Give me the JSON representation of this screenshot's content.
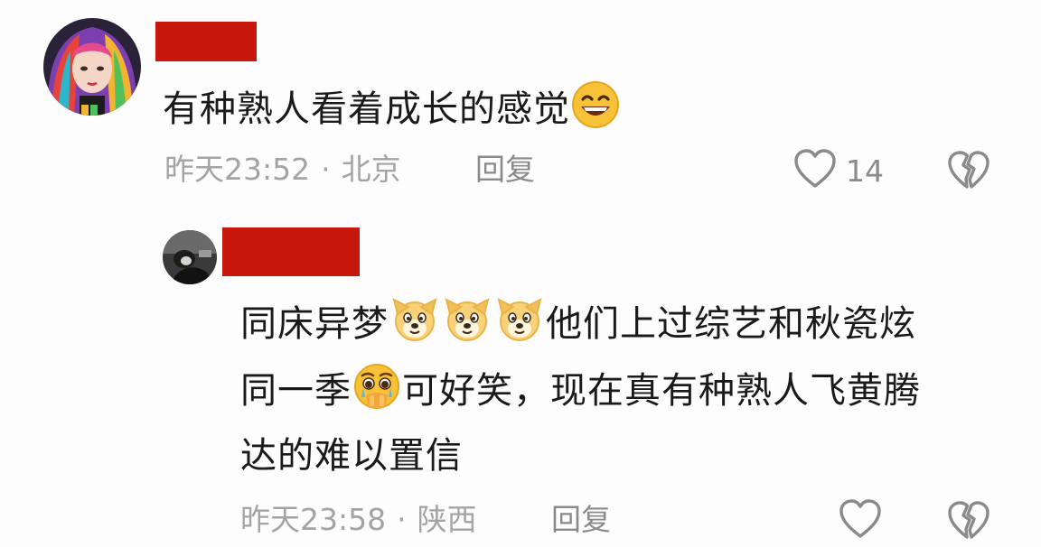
{
  "comment": {
    "text_before_emoji": "有种熟人看着成长的感觉",
    "emoji": "grinning-face",
    "time": "昨天23:52",
    "separator": "·",
    "location": "北京",
    "reply_label": "回复",
    "like_count": "14"
  },
  "reply": {
    "line1_start": "同床异梦",
    "line1_emoji": "dog-face x3",
    "line1_end": "他们上过综艺和秋瓷炫",
    "line2_start": "同一季",
    "line2_emoji": "pleading-crying-face",
    "line2_end": "可好笑，现在真有种熟人飞黄腾",
    "line3": "达的难以置信",
    "time": "昨天23:58",
    "separator": "·",
    "location": "陕西",
    "reply_label": "回复"
  },
  "colors": {
    "redaction": "#c8170c",
    "meta_text": "#a4a4a4",
    "body_text": "#1a1a1a"
  }
}
